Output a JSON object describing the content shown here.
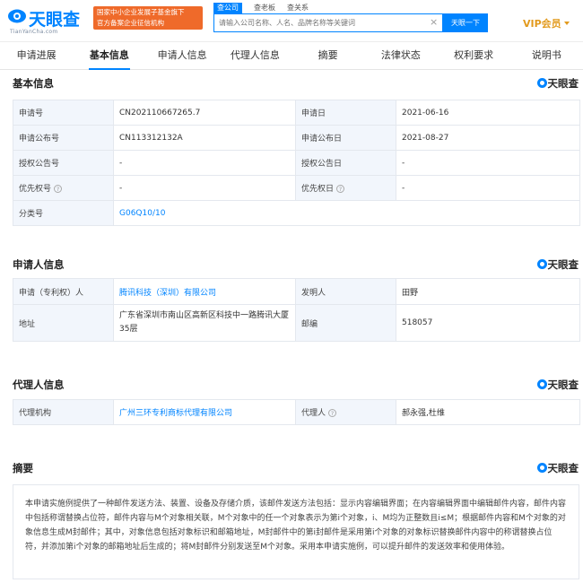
{
  "header": {
    "logo_text": "天眼查",
    "logo_sub": "TianYanCha.com",
    "slogan_line1": "国家中小企业发展子基金旗下",
    "slogan_line2": "官方备案企业征信机构",
    "search_tabs": [
      "查公司",
      "查老板",
      "查关系"
    ],
    "search_placeholder": "请输入公司名称、人名、品牌名称等关键词",
    "search_button": "天眼一下",
    "vip_label": "VIP会员"
  },
  "tabs": [
    "申请进展",
    "基本信息",
    "申请人信息",
    "代理人信息",
    "摘要",
    "法律状态",
    "权利要求",
    "说明书"
  ],
  "watermark": "天眼查",
  "basic": {
    "title": "基本信息",
    "rows": [
      [
        "申请号",
        "CN202110667265.7",
        "申请日",
        "2021-06-16"
      ],
      [
        "申请公布号",
        "CN113312132A",
        "申请公布日",
        "2021-08-27"
      ],
      [
        "授权公告号",
        "-",
        "授权公告日",
        "-"
      ],
      [
        "优先权号",
        "-",
        "优先权日",
        "-"
      ]
    ],
    "class_label": "分类号",
    "class_value": "G06Q10/10"
  },
  "applicant": {
    "title": "申请人信息",
    "applicant_label": "申请（专利权）人",
    "applicant_value": "腾讯科技（深圳）有限公司",
    "inventor_label": "发明人",
    "inventor_value": "田野",
    "address_label": "地址",
    "address_value": "广东省深圳市南山区高新区科技中一路腾讯大厦35层",
    "zip_label": "邮编",
    "zip_value": "518057"
  },
  "agent": {
    "title": "代理人信息",
    "org_label": "代理机构",
    "org_value": "广州三环专利商标代理有限公司",
    "agent_label": "代理人",
    "agent_value": "郝永强,杜维"
  },
  "abstract": {
    "title": "摘要",
    "text": "本申请实施例提供了一种邮件发送方法、装置、设备及存储介质，该邮件发送方法包括：显示内容编辑界面；在内容编辑界面中编辑邮件内容，邮件内容中包括称谓替换占位符，邮件内容与M个对象相关联，M个对象中的任一个对象表示为第i个对象，i、M均为正整数且i≤M；根据邮件内容和M个对象的对象信息生成M封邮件；其中，对象信息包括对象标识和邮箱地址，M封邮件中的第i封邮件是采用第i个对象的对象标识替换邮件内容中的称谓替换占位符，并添加第i个对象的邮箱地址后生成的；将M封邮件分别发送至M个对象。采用本申请实施例，可以提升邮件的发送效率和使用体验。"
  },
  "colors": {
    "accent": "#0084ff",
    "vip": "#e29a1d",
    "slogan_bg": "#ef6a2a",
    "key_cell_bg": "#f2f6fc"
  }
}
